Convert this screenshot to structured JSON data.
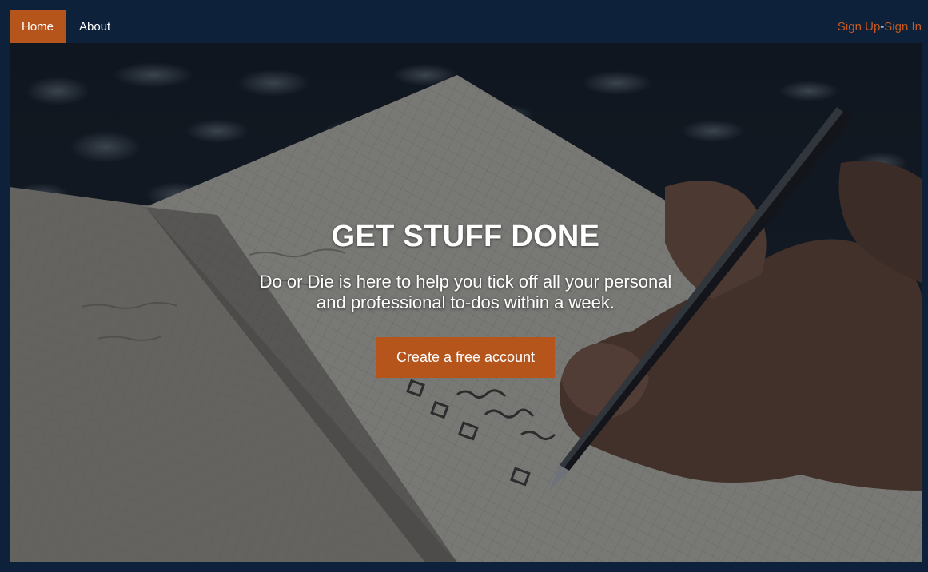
{
  "navbar": {
    "home_label": "Home",
    "about_label": "About",
    "signup_label": "Sign Up",
    "separator": "-",
    "signin_label": "Sign In"
  },
  "hero": {
    "title": "GET STUFF DONE",
    "subtitle": "Do or Die is here to help you tick off all your personal and professional to-dos within a week.",
    "cta_label": "Create a free account"
  },
  "colors": {
    "page_background": "#0d213a",
    "accent": "#b5541b",
    "link": "#c35a22",
    "text_light": "#ffffff"
  }
}
